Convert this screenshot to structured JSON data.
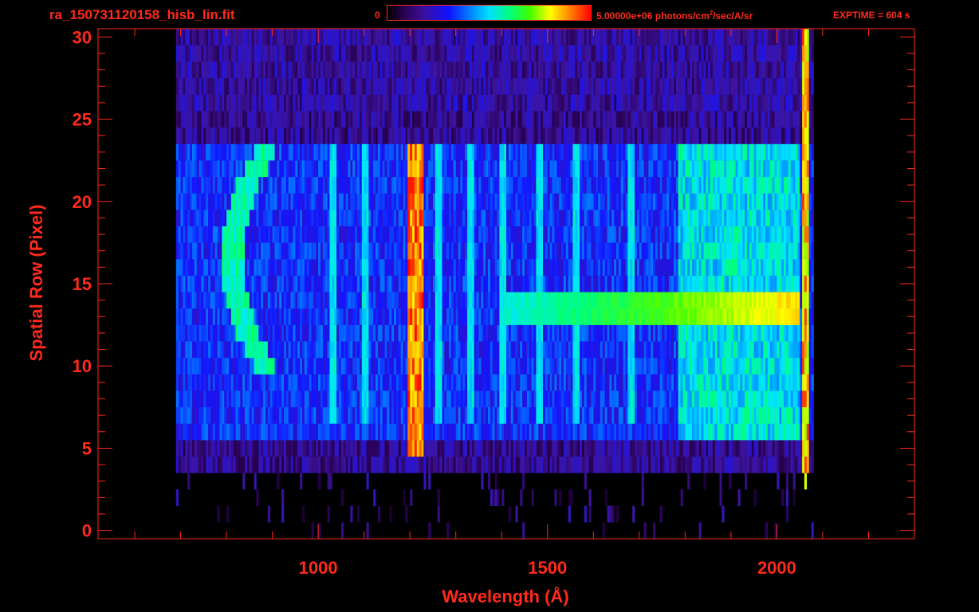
{
  "header": {
    "filename": "ra_150731120158_hisb_lin.fit",
    "colorbar_min": "0",
    "colorbar_max_prefix": "5.00000e+06 photons/cm",
    "colorbar_max_sup": "2",
    "colorbar_max_suffix": "/sec/A/sr",
    "exptime": "EXPTIME = 604 s"
  },
  "colors": {
    "axis": "#ff2a1a",
    "background": "#000000"
  },
  "chart_data": {
    "type": "heatmap",
    "title": "ra_150731120158_hisb_lin.fit",
    "xlabel": "Wavelength (Å)",
    "ylabel": "Spatial Row (Pixel)",
    "xlim": [
      520,
      2300
    ],
    "ylim": [
      -0.5,
      30.5
    ],
    "x_ticks": [
      1000,
      1500,
      2000
    ],
    "x_tick_labels": [
      "1000",
      "1500",
      "2000"
    ],
    "y_ticks": [
      0,
      5,
      10,
      15,
      20,
      25,
      30
    ],
    "y_tick_labels": [
      "0",
      "5",
      "10",
      "15",
      "20",
      "25",
      "30"
    ],
    "colorbar": {
      "min": 0,
      "max": 5000000,
      "units": "photons/cm^2/sec/A/sr",
      "colormap": [
        "#000000",
        "#3a10a0",
        "#1010ff",
        "#00e0ff",
        "#00ff80",
        "#ffff00",
        "#ff8000",
        "#ff0000"
      ]
    },
    "data_extent": {
      "x": [
        690,
        2075
      ],
      "y": [
        0,
        30
      ]
    },
    "bright_features": [
      {
        "name": "Lyman-alpha line",
        "x": 1216,
        "rows": [
          5,
          24
        ],
        "level": "max"
      },
      {
        "name": "edge",
        "x": 2060,
        "rows": [
          0,
          30
        ],
        "level": "high"
      },
      {
        "name": "continuum band",
        "x": [
          1450,
          2050
        ],
        "rows": [
          13,
          15
        ],
        "level": "high"
      },
      {
        "name": "arc",
        "x": [
          780,
          900
        ],
        "rows": [
          10,
          24
        ],
        "level": "medium"
      }
    ]
  }
}
